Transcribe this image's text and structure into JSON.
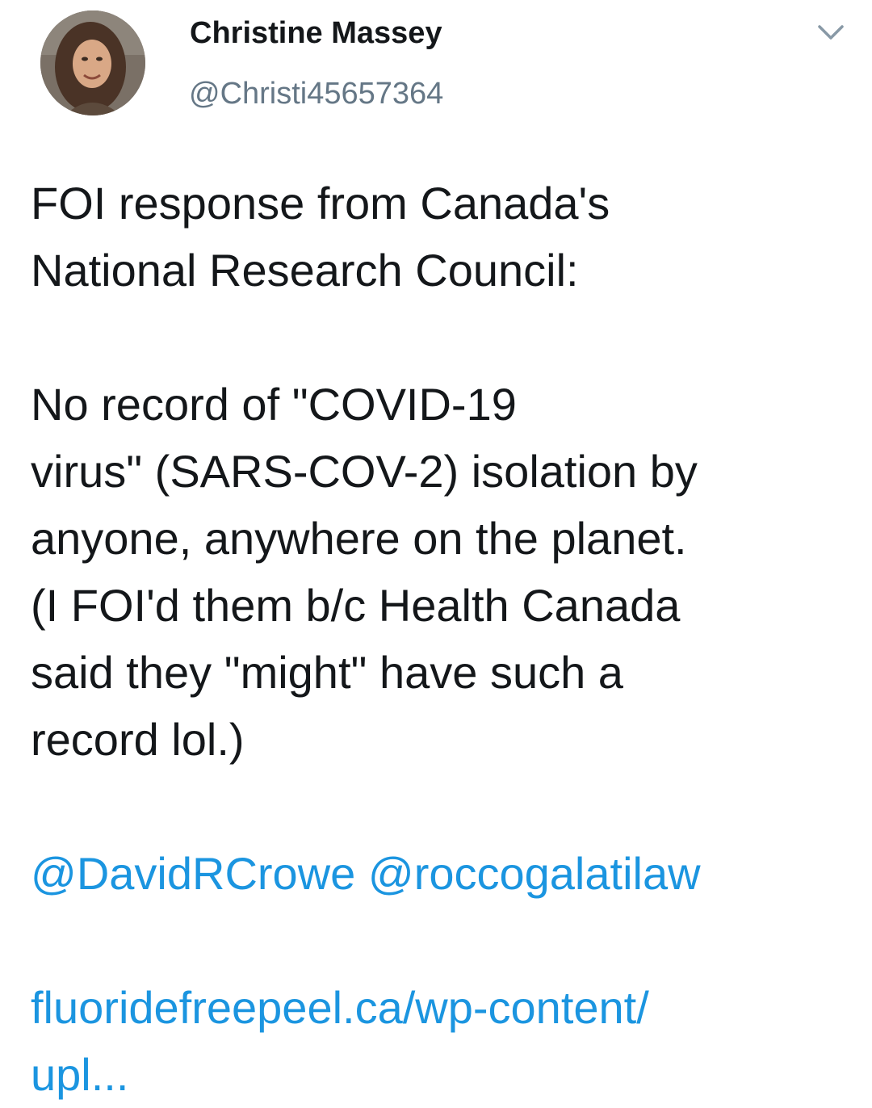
{
  "user": {
    "display_name": "Christine Massey",
    "handle": "@Christi45657364"
  },
  "tweet": {
    "paragraph1": [
      "FOI response from Canada's",
      "National Research Council:"
    ],
    "paragraph2": [
      "No record of \"COVID-19",
      "virus\" (SARS-COV-2) isolation by",
      "anyone, anywhere on the planet.",
      "(I FOI'd them b/c Health Canada",
      "said they \"might\" have such a",
      "record lol.)"
    ],
    "mentions": [
      "@DavidRCrowe",
      "@roccogalatilaw"
    ],
    "link_lines": [
      "fluoridefreepeel.ca/wp-content/",
      "upl..."
    ]
  },
  "icons": {
    "avatar": "avatar-photo",
    "menu": "chevron-down-icon"
  },
  "colors": {
    "text": "#14171a",
    "secondary": "#657786",
    "link": "#1b95e0",
    "background": "#ffffff"
  }
}
